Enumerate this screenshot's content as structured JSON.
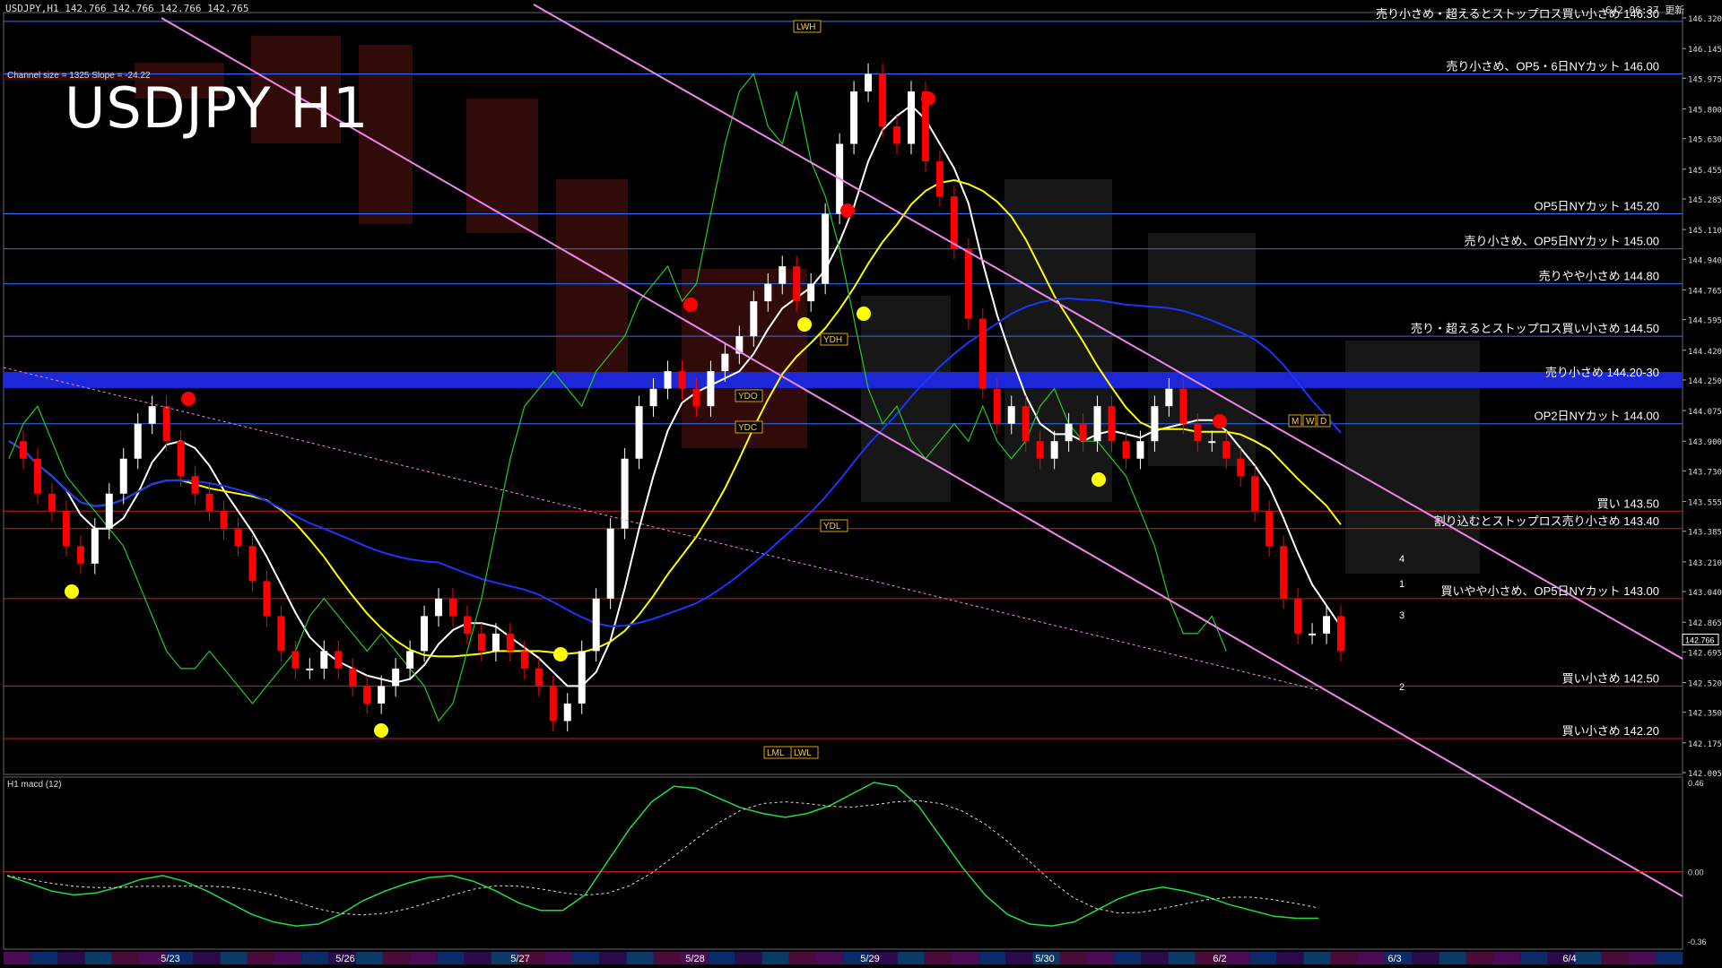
{
  "header": {
    "symbol_info": "USDJPY,H1  142.766 142.766 142.766 142.765",
    "timestamp": "6/2 06:37 更新",
    "title": "USDJPY H1",
    "channel_info": "Channel size = 1325 Slope = -24.22"
  },
  "macd_label": "H1 macd (12)",
  "colors": {
    "background": "#000000",
    "up_candle": "#ffffff",
    "down_candle": "#ff0000",
    "ma_white": "#ffffff",
    "ma_yellow": "#ffff00",
    "ma_blue": "#1a35ff",
    "chikou_green": "#22cc22",
    "channel_violet": "#ee88ee",
    "level_blue": "#2a6fff",
    "level_red": "#cc2020"
  },
  "chart_data": {
    "type": "candlestick",
    "symbol": "USDJPY",
    "timeframe": "H1",
    "ylim": [
      142.005,
      146.32
    ],
    "y_ticks": [
      146.32,
      146.145,
      145.975,
      145.8,
      145.63,
      145.455,
      145.285,
      145.11,
      144.94,
      144.765,
      144.595,
      144.42,
      144.25,
      144.075,
      143.9,
      143.73,
      143.555,
      143.385,
      143.21,
      143.04,
      142.865,
      142.695,
      142.52,
      142.35,
      142.175,
      142.005
    ],
    "current_price": 142.766,
    "x_tick_labels": [
      "5/23",
      "5/26",
      "5/27",
      "5/28",
      "5/29",
      "5/30",
      "6/2",
      "6/3",
      "6/4"
    ],
    "levels": [
      {
        "price": 146.3,
        "label": "売り小さめ・超えるとストップロス買い小さめ 146.30",
        "color": "blue"
      },
      {
        "price": 146.0,
        "label": "売り小さめ、OP5・6日NYカット 146.00",
        "color": "blue"
      },
      {
        "price": 145.2,
        "label": "OP5日NYカット 145.20",
        "color": "blue"
      },
      {
        "price": 145.0,
        "label": "売り小さめ、OP5日NYカット 145.00",
        "color": "blue"
      },
      {
        "price": 144.8,
        "label": "売りやや小さめ 144.80",
        "color": "blue"
      },
      {
        "price": 144.5,
        "label": "売り・超えるとストップロス買い小さめ 144.50",
        "color": "blue"
      },
      {
        "price": 144.25,
        "label": "売り小さめ 144.20-30",
        "color": "band"
      },
      {
        "price": 144.0,
        "label": "OP2日NYカット 144.00",
        "color": "blue"
      },
      {
        "price": 143.5,
        "label": "買い 143.50",
        "color": "red"
      },
      {
        "price": 143.4,
        "label": "割り込むとストップロス売り小さめ 143.40",
        "color": "red"
      },
      {
        "price": 143.0,
        "label": "買いやや小さめ、OP5日NYカット 143.00",
        "color": "red"
      },
      {
        "price": 142.5,
        "label": "買い小さめ 142.50",
        "color": "red"
      },
      {
        "price": 142.2,
        "label": "買い小さめ 142.20",
        "color": "red"
      }
    ],
    "box_labels": [
      "LWH",
      "YDH",
      "YDO",
      "YDC",
      "YDL",
      "LML",
      "LWL",
      "M",
      "W",
      "D"
    ],
    "projection_labels": [
      "4",
      "1",
      "3",
      "2"
    ],
    "series": [
      {
        "name": "close",
        "values": [
          143.9,
          143.8,
          143.6,
          143.5,
          143.3,
          143.2,
          143.4,
          143.6,
          143.8,
          144.0,
          144.1,
          143.9,
          143.7,
          143.6,
          143.5,
          143.4,
          143.3,
          143.1,
          142.9,
          142.7,
          142.6,
          142.6,
          142.7,
          142.6,
          142.5,
          142.4,
          142.5,
          142.6,
          142.7,
          142.9,
          143.0,
          142.9,
          142.8,
          142.7,
          142.8,
          142.7,
          142.6,
          142.5,
          142.3,
          142.4,
          142.7,
          143.0,
          143.4,
          143.8,
          144.1,
          144.2,
          144.3,
          144.2,
          144.1,
          144.3,
          144.4,
          144.5,
          144.7,
          144.8,
          144.9,
          144.7,
          144.8,
          145.2,
          145.6,
          145.9,
          146.0,
          145.7,
          145.6,
          145.9,
          145.5,
          145.3,
          145.0,
          144.6,
          144.2,
          144.0,
          144.1,
          143.9,
          143.8,
          143.9,
          144.0,
          143.9,
          144.1,
          143.9,
          143.8,
          143.9,
          144.1,
          144.2,
          144.0,
          143.9,
          143.9,
          143.8,
          143.7,
          143.5,
          143.3,
          143.0,
          142.8,
          142.8,
          142.9,
          142.7
        ]
      },
      {
        "name": "macd",
        "ylim": [
          -0.358,
          0.46
        ],
        "values": [
          -0.02,
          -0.06,
          -0.1,
          -0.12,
          -0.11,
          -0.08,
          -0.04,
          -0.02,
          -0.05,
          -0.1,
          -0.16,
          -0.22,
          -0.26,
          -0.28,
          -0.27,
          -0.22,
          -0.15,
          -0.1,
          -0.06,
          -0.03,
          -0.02,
          -0.05,
          -0.1,
          -0.16,
          -0.2,
          -0.2,
          -0.12,
          0.05,
          0.22,
          0.36,
          0.44,
          0.43,
          0.38,
          0.33,
          0.3,
          0.28,
          0.3,
          0.34,
          0.4,
          0.46,
          0.44,
          0.34,
          0.18,
          0.02,
          -0.12,
          -0.22,
          -0.27,
          -0.28,
          -0.26,
          -0.2,
          -0.14,
          -0.1,
          -0.08,
          -0.1,
          -0.13,
          -0.17,
          -0.2,
          -0.23,
          -0.24,
          -0.24
        ]
      }
    ]
  }
}
